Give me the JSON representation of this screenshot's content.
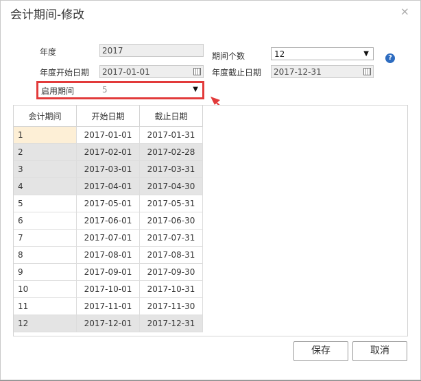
{
  "dialog": {
    "title": "会计期间-修改",
    "close": "×"
  },
  "form": {
    "year_label": "年度",
    "year_value": "2017",
    "period_count_label": "期间个数",
    "period_count_value": "12",
    "start_date_label": "年度开始日期",
    "start_date_value": "2017-01-01",
    "end_date_label": "年度截止日期",
    "end_date_value": "2017-12-31",
    "enable_period_label": "启用期间",
    "enable_period_value": "5",
    "help": "?"
  },
  "table": {
    "headers": [
      "会计期间",
      "开始日期",
      "截止日期"
    ],
    "rows": [
      [
        "1",
        "2017-01-01",
        "2017-01-31"
      ],
      [
        "2",
        "2017-02-01",
        "2017-02-28"
      ],
      [
        "3",
        "2017-03-01",
        "2017-03-31"
      ],
      [
        "4",
        "2017-04-01",
        "2017-04-30"
      ],
      [
        "5",
        "2017-05-01",
        "2017-05-31"
      ],
      [
        "6",
        "2017-06-01",
        "2017-06-30"
      ],
      [
        "7",
        "2017-07-01",
        "2017-07-31"
      ],
      [
        "8",
        "2017-08-01",
        "2017-08-31"
      ],
      [
        "9",
        "2017-09-01",
        "2017-09-30"
      ],
      [
        "10",
        "2017-10-01",
        "2017-10-31"
      ],
      [
        "11",
        "2017-11-01",
        "2017-11-30"
      ],
      [
        "12",
        "2017-12-01",
        "2017-12-31"
      ]
    ]
  },
  "buttons": {
    "save": "保存",
    "cancel": "取消"
  },
  "colors": {
    "highlight": "#e23a3a",
    "help": "#2d6cc0",
    "gray_row": "#e4e4e4",
    "selected_cell": "#fdefd6"
  }
}
